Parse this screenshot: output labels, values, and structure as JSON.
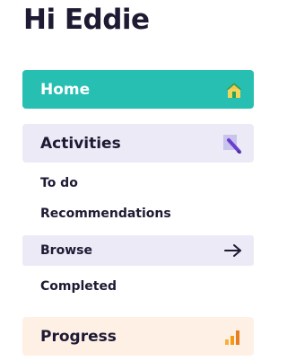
{
  "greeting": "Hi Eddie",
  "nav": {
    "home": {
      "label": "Home",
      "icon": "home-icon",
      "color": "#27bfb2"
    },
    "activities": {
      "label": "Activities",
      "icon": "pencil-icon",
      "color": "#eceaf6",
      "items": [
        {
          "label": "To do"
        },
        {
          "label": "Recommendations"
        },
        {
          "label": "Browse",
          "icon": "arrow-right-icon"
        },
        {
          "label": "Completed"
        }
      ]
    },
    "progress": {
      "label": "Progress",
      "icon": "bar-chart-icon",
      "color": "#fff0e6"
    }
  }
}
